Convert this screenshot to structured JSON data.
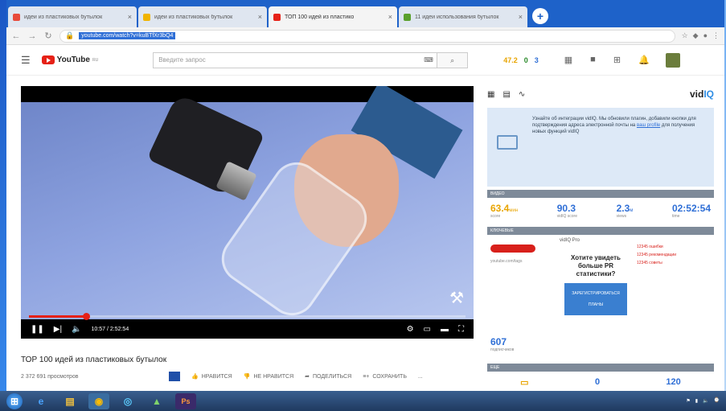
{
  "browser": {
    "tabs": [
      {
        "title": "идеи из пластиковых бутылок",
        "color": "#e84a3a",
        "active": false
      },
      {
        "title": "идеи из пластиковых бутылок",
        "color": "#f0b400",
        "active": false
      },
      {
        "title": "ТОП 100 идей из пластико",
        "color": "#e62117",
        "active": true
      },
      {
        "title": "11 идеи использования бутылок",
        "color": "#5aa02c",
        "active": false
      }
    ],
    "tab_close": "×",
    "new_tab": "+",
    "url": "youtube.com/watch?v=kuBTfXr3bQ4"
  },
  "youtube": {
    "logo_text": "YouTube",
    "logo_sup": "RU",
    "search_placeholder": "Введите запрос",
    "stats": [
      "47.2",
      "0",
      "3"
    ]
  },
  "player": {
    "time": "10:57 / 2:52:54",
    "progress": 0.13
  },
  "video": {
    "title": "ТОР 100 идей из пластиковых бутылок",
    "views": "2 372 691 просмотров",
    "like_label": "Нравится",
    "dislike_label": "Не нравится",
    "share_label": "Поделиться",
    "save_label": "Сохранить",
    "more_label": "..."
  },
  "vidiq": {
    "brand_prefix": "vid",
    "brand_suffix": "IQ",
    "info_text": "Узнайте об интеграции vidIQ. Мы обновили плагин, добавили кнопки для подтверждения адреса электронной почты на",
    "info_link": "ваш profile",
    "info_text2": "для получения новых функций vidIQ",
    "section1": "ВИДЕО",
    "metrics": [
      {
        "value": "63.4",
        "unit": "мин",
        "label": "score"
      },
      {
        "value": "90.3",
        "unit": "",
        "label": "vidIQ score"
      },
      {
        "value": "2.3",
        "unit": "м",
        "label": "views"
      },
      {
        "value": "02:52:54",
        "unit": "",
        "label": "time"
      }
    ],
    "section2": "КЛЮЧЕВЫЕ",
    "kw_sub": "youtube.com/tags",
    "kw_tag": "vidIQ Pro",
    "promo": "Хотите увидеть больше PR статистики?",
    "promo_btn1": "ЗАРЕГИСТРИРОВАТЬСЯ",
    "promo_btn2": "ПЛАНЫ",
    "kw_right": [
      "12345 ошибки",
      "12345 рекомендации",
      "12345 советы"
    ],
    "subs_value": "607",
    "subs_label": "подписчиков",
    "section3": "ЕЩЕ",
    "bottom_values": [
      "0",
      "120"
    ]
  }
}
